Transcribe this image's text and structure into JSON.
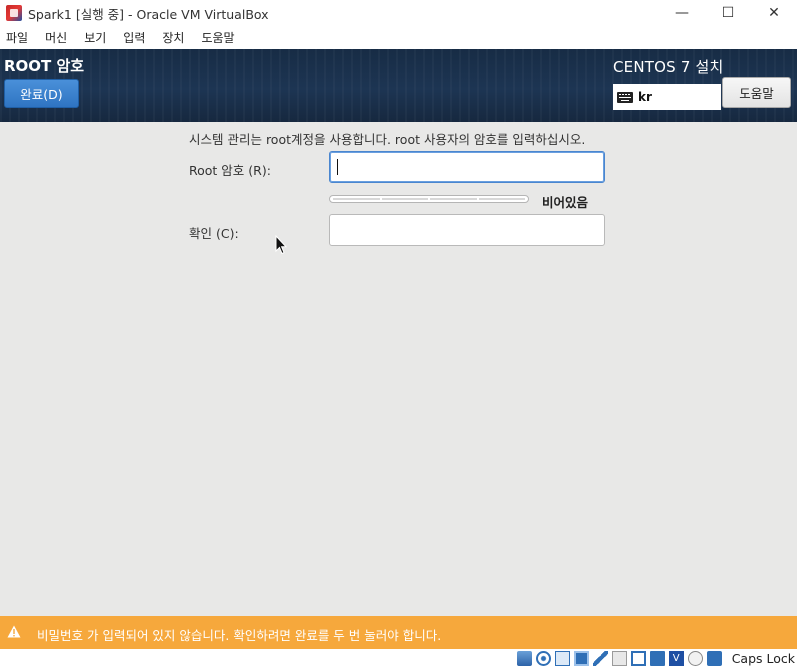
{
  "window": {
    "title": "Spark1 [실행 중] - Oracle VM VirtualBox",
    "minimize_glyph": "—",
    "maximize_glyph": "☐",
    "close_glyph": "✕"
  },
  "menu": {
    "items": [
      "파일",
      "머신",
      "보기",
      "입력",
      "장치",
      "도움말"
    ]
  },
  "installer": {
    "page_title": "ROOT 암호",
    "done_label": "완료(D)",
    "product_title": "CENTOS 7 설치",
    "keyboard_layout": "kr",
    "help_label": "도움말"
  },
  "root_password": {
    "instruction": "시스템 관리는 root계정을 사용합니다. root 사용자의 암호를 입력하십시오.",
    "root_label": "Root 암호 (R):",
    "root_value": "",
    "confirm_label": "확인 (C):",
    "confirm_value": "",
    "strength_text": "비어있음",
    "strength_level": 0
  },
  "warning": {
    "text": "비밀번호 가 입력되어 있지 않습니다.  확인하려면 완료를 두 번 눌러야 합니다."
  },
  "statusbar": {
    "caps_lock": "Caps Lock",
    "vt_glyph": "V"
  },
  "colors": {
    "header_bg": "#1d3553",
    "done_button": "#3a80cc",
    "warning_bg": "#f6a83c",
    "content_bg": "#e8e8e7"
  }
}
